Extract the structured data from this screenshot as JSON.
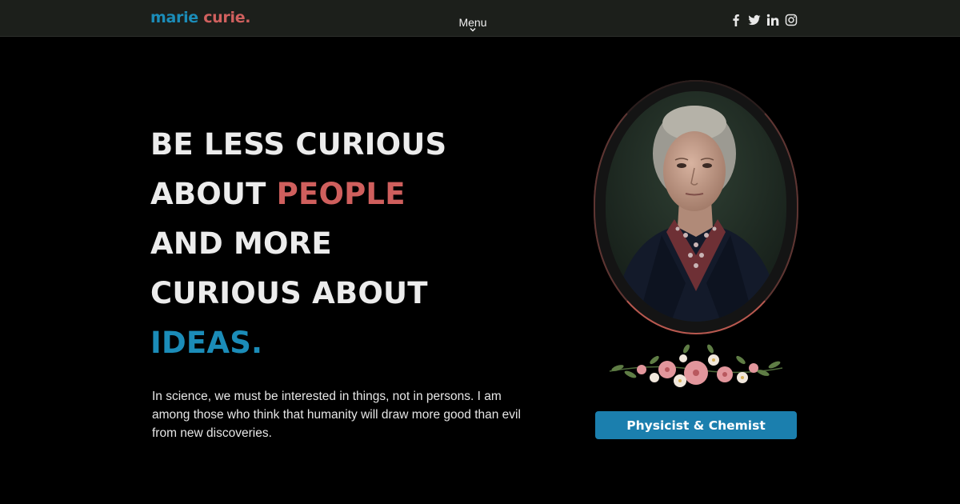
{
  "brand": {
    "first": "marie",
    "last": "curie."
  },
  "nav": {
    "menu_label": "Menu"
  },
  "socials": [
    "facebook-icon",
    "twitter-icon",
    "linkedin-icon",
    "instagram-icon"
  ],
  "hero": {
    "headline": {
      "line1": "BE LESS CURIOUS",
      "line2_a": "ABOUT ",
      "line2_b": "PEOPLE",
      "line3": "AND MORE",
      "line4": "CURIOUS ABOUT",
      "line5": "IDEAS."
    },
    "quote": "In science, we must be interested in things, not in persons. I am among those who think that humanity will draw more good than evil from new discoveries."
  },
  "profile": {
    "role_label": "Physicist & Chemist"
  },
  "colors": {
    "accent_blue": "#1b8cb8",
    "accent_red": "#cf5f5d",
    "button": "#1b7fae",
    "navbar": "#1c1f1b"
  }
}
